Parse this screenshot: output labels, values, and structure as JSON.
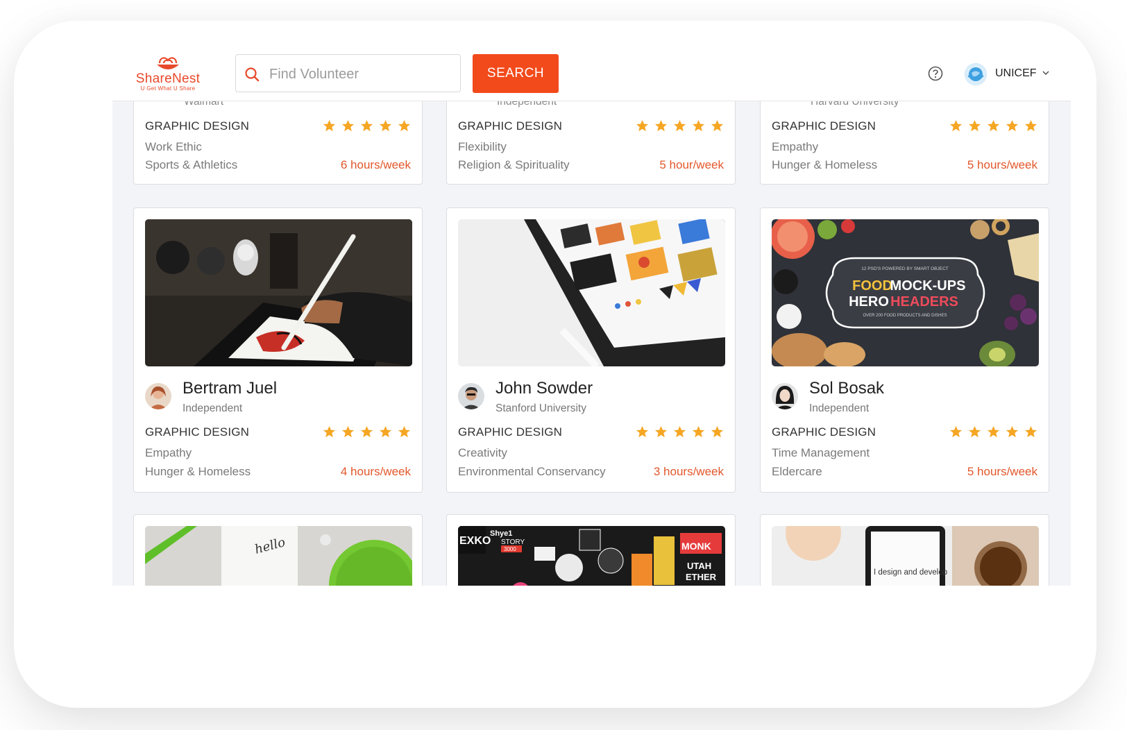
{
  "brand": {
    "name": "ShareNest",
    "tagline": "U Get What U Share",
    "accent": "#F24A1B"
  },
  "search": {
    "placeholder": "Find Volunteer",
    "button_label": "SEARCH"
  },
  "user_menu": {
    "org_name": "UNICEF",
    "help_icon": "help-circle-icon",
    "chevron_icon": "chevron-down-icon"
  },
  "cards_top": [
    {
      "org": "Walmart",
      "category": "GRAPHIC DESIGN",
      "rating": 5,
      "skill": "Work Ethic",
      "cause": "Sports & Athletics",
      "hours": "6 hours/week"
    },
    {
      "org": "Independent",
      "category": "GRAPHIC DESIGN",
      "rating": 5,
      "skill": "Flexibility",
      "cause": "Religion & Spirituality",
      "hours": "5 hour/week"
    },
    {
      "org": "Harvard University",
      "category": "GRAPHIC DESIGN",
      "rating": 5,
      "skill": "Empathy",
      "cause": "Hunger & Homeless",
      "hours": "5 hours/week"
    }
  ],
  "cards_middle": [
    {
      "name": "Bertram Juel",
      "org": "Independent",
      "category": "GRAPHIC DESIGN",
      "rating": 5,
      "skill": "Empathy",
      "cause": "Hunger & Homeless",
      "hours": "4 hours/week",
      "image": "tablet-drawing"
    },
    {
      "name": "John Sowder",
      "org": "Stanford University",
      "category": "GRAPHIC DESIGN",
      "rating": 5,
      "skill": "Creativity",
      "cause": "Environmental Conservancy",
      "hours": "3 hours/week",
      "image": "ipad-design-grid"
    },
    {
      "name": "Sol Bosak",
      "org": "Independent",
      "category": "GRAPHIC DESIGN",
      "rating": 5,
      "skill": "Time Management",
      "cause": "Eldercare",
      "hours": "5 hours/week",
      "image": "food-mockups"
    }
  ],
  "food_image_text": {
    "small": "12 PSD'S POWERED BY SMART OBJECT",
    "line1a": "FOOD",
    "line1b": "MOCK-UPS",
    "line2a": "HERO",
    "line2b": "HEADERS",
    "sub": "OVER 200 FOOD PRODUCTS AND DISHES"
  },
  "cards_bottom": [
    {
      "image": "hello-notebook",
      "image_text": "hello"
    },
    {
      "image": "sticker-collage",
      "stickers": [
        "EXKO",
        "Shye1",
        "STORY",
        "3000",
        "MONK",
        "UTAH",
        "ETHER"
      ]
    },
    {
      "image": "phone-and-drink",
      "phone_text": "I design and develop"
    }
  ]
}
